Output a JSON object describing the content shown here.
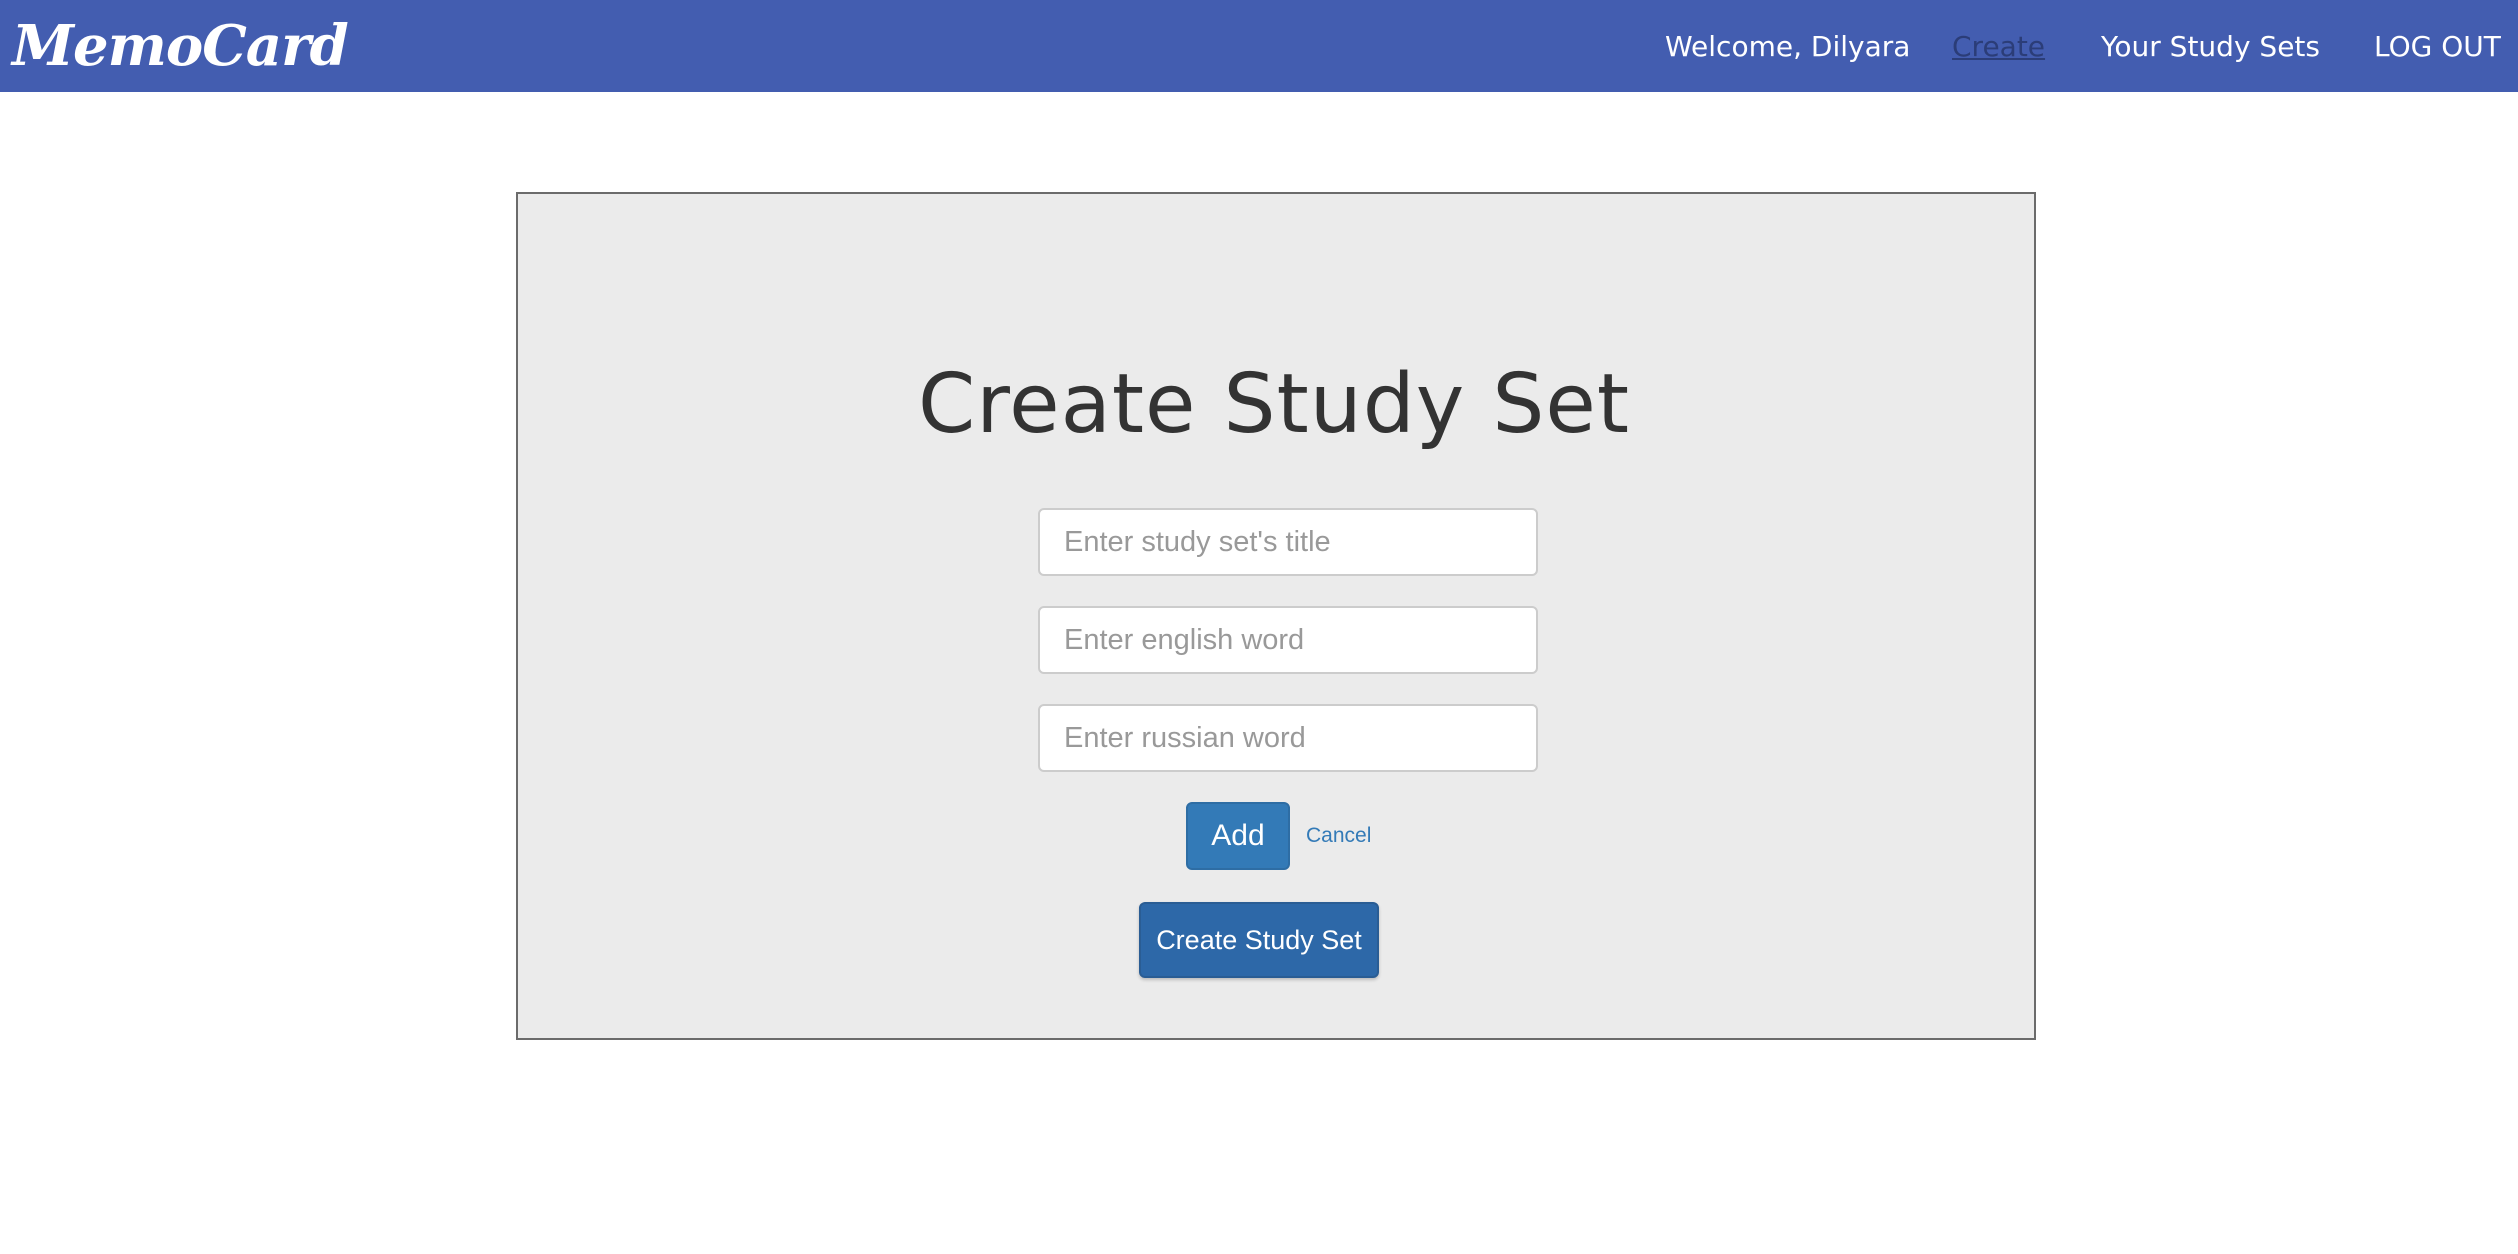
{
  "navbar": {
    "brand": "MemoCard",
    "welcome": "Welcome, Dilyara",
    "create": "Create",
    "study_sets": "Your Study Sets",
    "logout": "LOG OUT",
    "colors": {
      "background": "#435db0",
      "active_link": "#2b3d78"
    }
  },
  "main": {
    "title": "Create Study Set",
    "fields": {
      "title_placeholder": "Enter study set's title",
      "english_placeholder": "Enter english word",
      "russian_placeholder": "Enter russian word"
    },
    "add_label": "Add",
    "cancel_label": "Cancel",
    "create_label": "Create Study Set",
    "colors": {
      "panel": "#ebebeb",
      "primary_button": "#337ab7"
    }
  }
}
